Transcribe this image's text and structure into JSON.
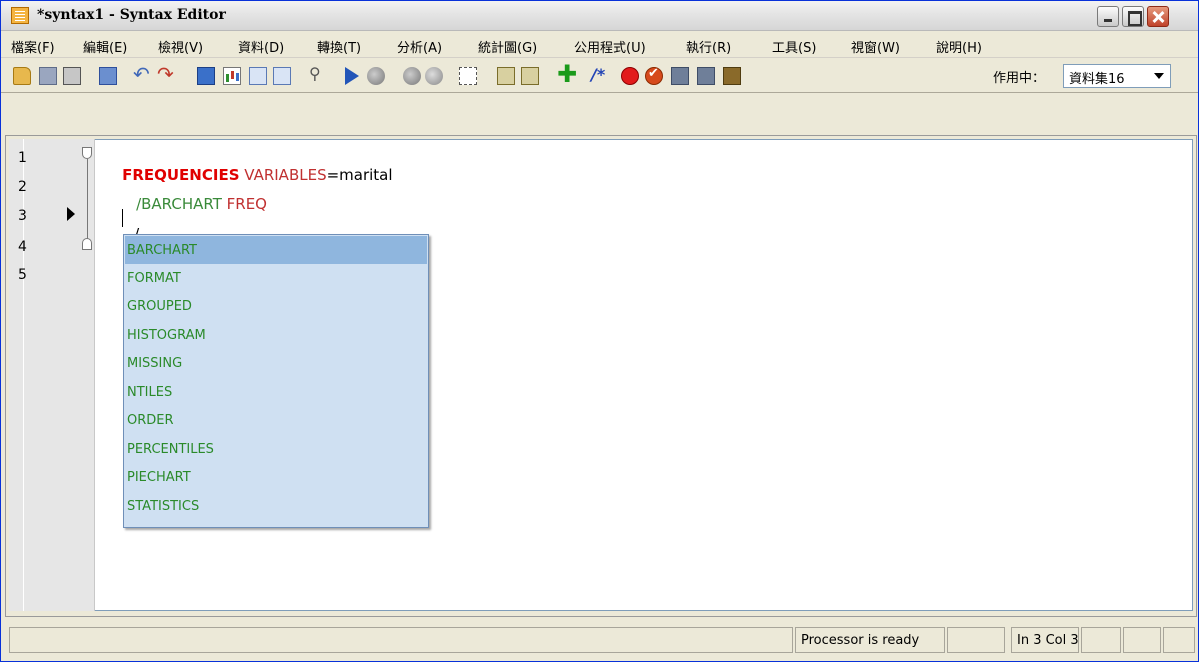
{
  "window": {
    "title": "*syntax1 - Syntax Editor"
  },
  "menu": [
    "檔案(F)",
    "編輯(E)",
    "檢視(V)",
    "資料(D)",
    "轉換(T)",
    "分析(A)",
    "統計圖(G)",
    "公用程式(U)",
    "執行(R)",
    "工具(S)",
    "視窗(W)",
    "說明(H)"
  ],
  "toolbar": {
    "active_label": "作用中：",
    "dataset": "資料集16",
    "icons": [
      "open-icon",
      "save-icon",
      "print-icon",
      "goto-data-icon",
      "undo-icon",
      "redo-icon",
      "data-grid-icon",
      "chart-icon",
      "insert-variable-icon",
      "variable-info-icon",
      "find-icon",
      "run-icon",
      "stop-icon",
      "globe-icon",
      "globe-icon",
      "select-icon",
      "syntax-help-icon",
      "add-icon",
      "comment-icon",
      "breakpoint-icon",
      "clear-breakpoints-icon",
      "bookmark-icon",
      "bookmark-icon",
      "bookmark-icon"
    ]
  },
  "editor": {
    "line_numbers": [
      "1",
      "2",
      "3",
      "4",
      "5"
    ],
    "lines": [
      {
        "kw": "FREQUENCIES",
        "rest1": " VARIABLES",
        "rest2": "=marital"
      },
      {
        "sub": "/BARCHART",
        "rest": " FREQ"
      },
      {
        "text": "/"
      },
      {
        "text": "/"
      }
    ]
  },
  "autocomplete": {
    "items": [
      "BARCHART",
      "FORMAT",
      "GROUPED",
      "HISTOGRAM",
      "MISSING",
      "NTILES",
      "ORDER",
      "PERCENTILES",
      "PIECHART",
      "STATISTICS"
    ],
    "selected": "BARCHART"
  },
  "status": {
    "processor": "Processor is ready",
    "position": "In 3 Col 3"
  },
  "colors": {
    "keyword": "#e00000",
    "subcommand": "#3a8a3a",
    "popup_bg": "#cfe0f2",
    "popup_selected": "#8fb6de"
  }
}
